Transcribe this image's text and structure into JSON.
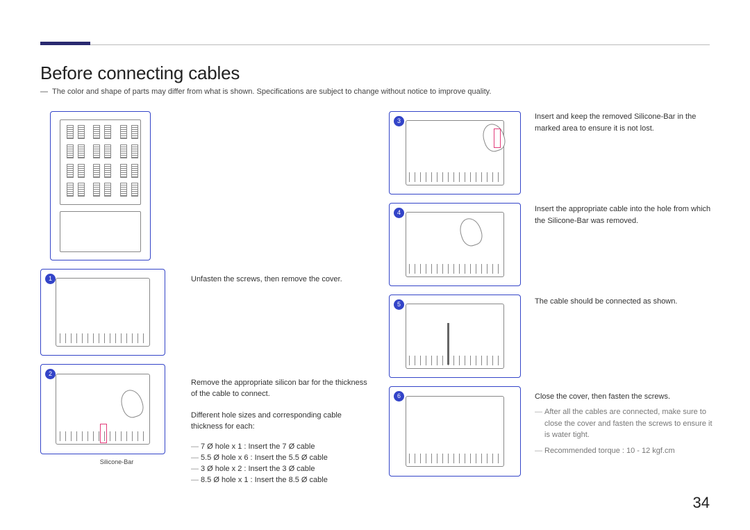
{
  "page_number": "34",
  "title": "Before connecting cables",
  "intro_note": "The color and shape of parts may differ from what is shown. Specifications are subject to change without notice to improve quality.",
  "fig2_caption": "Silicone-Bar",
  "steps": {
    "s1": "Unfasten the screws, then remove the cover.",
    "s2a": "Remove the appropriate silicon bar for the thickness of the cable to connect.",
    "s2b": "Different hole sizes and corresponding cable thickness for each:",
    "s2_list": {
      "i1": "7 Ø hole x 1 : Insert the 7 Ø cable",
      "i2": "5.5 Ø hole x 6 : Insert the 5.5 Ø cable",
      "i3": "3 Ø hole x 2 : Insert the 3 Ø cable",
      "i4": "8.5 Ø hole x 1 : Insert the 8.5 Ø cable"
    },
    "s3": "Insert and keep the removed Silicone-Bar in the marked area to ensure it is not lost.",
    "s4": "Insert the appropriate cable into the hole from which the Silicone-Bar was removed.",
    "s5": "The cable should be connected as shown.",
    "s6": "Close the cover, then fasten the screws.",
    "s6_note1": "After all the cables are connected, make sure to close the cover and fasten the screws to ensure it is water tight.",
    "s6_note2": "Recommended torque : 10 - 12 kgf.cm"
  },
  "fig_numbers": {
    "n1": "1",
    "n2": "2",
    "n3": "3",
    "n4": "4",
    "n5": "5",
    "n6": "6"
  },
  "dash": "―"
}
